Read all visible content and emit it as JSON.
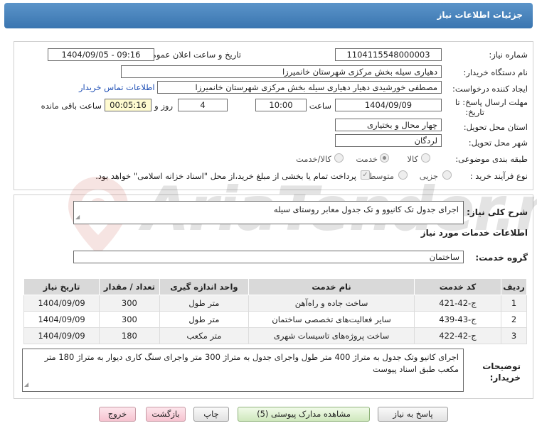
{
  "header": {
    "title": "جزئیات اطلاعات نیاز"
  },
  "need": {
    "number_label": "شماره نیاز:",
    "number": "1104115548000003",
    "announce_label": "تاریخ و ساعت اعلان عمومی:",
    "announce": "1404/09/05 - 09:16",
    "buyer_label": "نام دستگاه خریدار:",
    "buyer": "دهیاری سیله بخش مرکزی شهرستان خانمیرزا",
    "creator_label": "ایجاد کننده درخواست:",
    "creator": "مصطفی خورشیدی دهیار دهیاری سیله بخش مرکزی شهرستان خانمیرزا",
    "contact_link": "اطلاعات تماس خریدار",
    "deadline_label_1": "مهلت ارسال پاسخ: تا",
    "deadline_label_2": "تاریخ:",
    "deadline_date": "1404/09/09",
    "time_label": "ساعت",
    "deadline_time": "10:00",
    "days": "4",
    "days_label": "روز و",
    "remaining": "00:05:16",
    "remaining_label": "ساعت باقی مانده",
    "province_label": "استان محل تحویل:",
    "province": "چهار محال و بختیاری",
    "city_label": "شهر محل تحویل:",
    "city": "لردگان",
    "category_label": "طبقه بندی موضوعی:",
    "category_options": [
      "کالا",
      "خدمت",
      "کالا/خدمت"
    ],
    "category_selected": "خدمت",
    "process_label": "نوع فرآیند خرید :",
    "process_options": [
      "جزیی",
      "متوسط"
    ],
    "payment_note": "پرداخت تمام یا بخشی از مبلغ خرید،از محل \"اسناد خزانه اسلامی\" خواهد بود."
  },
  "summary": {
    "label": "شرح کلی نیاز:",
    "value": "اجرای جدول تک کانیوو و تک جدول معابر روستای سیله"
  },
  "services": {
    "section_title": "اطلاعات خدمات مورد نیاز",
    "group_label": "گروه خدمت:",
    "group": "ساختمان",
    "columns": [
      "ردیف",
      "کد خدمت",
      "نام خدمت",
      "واحد اندازه گیری",
      "تعداد / مقدار",
      "تاریخ نیاز"
    ],
    "rows": [
      {
        "row": "1",
        "code": "ج-42-421",
        "name": "ساخت جاده و راه‌آهن",
        "unit": "متر طول",
        "qty": "300",
        "date": "1404/09/09"
      },
      {
        "row": "2",
        "code": "ج-43-439",
        "name": "سایر فعالیت‌های تخصصی ساختمان",
        "unit": "متر طول",
        "qty": "300",
        "date": "1404/09/09"
      },
      {
        "row": "3",
        "code": "ج-42-422",
        "name": "ساخت پروژه‌های تاسیسات شهری",
        "unit": "متر مکعب",
        "qty": "180",
        "date": "1404/09/09"
      }
    ]
  },
  "buyer_notes": {
    "label_1": "توضیحات",
    "label_2": "خریدار:",
    "value": "اجرای کانیو وتک جدول به متراژ 400 متر طول واجرای جدول به متراژ 300 متر واجرای سنگ کاری دیوار به متراژ 180 متر مکعب طبق اسناد پیوست"
  },
  "watermark": {
    "text": "AriaTender.net"
  },
  "buttons": {
    "reply": "پاسخ به نیاز",
    "attachments": "مشاهده مدارک پیوستی (5)",
    "print": "چاپ",
    "back": "بازگشت",
    "exit": "خروج"
  },
  "colors": {
    "header": "#3a75b0",
    "link": "#1f4fb5",
    "remaining_bg": "#fffbd0",
    "watermark": "#c0392b"
  }
}
